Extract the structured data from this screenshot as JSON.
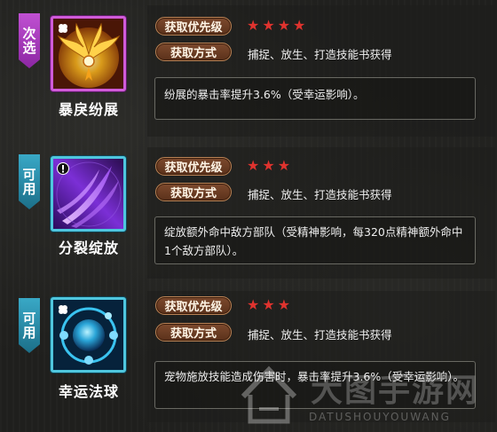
{
  "skills": [
    {
      "tag": "次选",
      "name": "暴戾纷展",
      "priority_label": "获取优先级",
      "stars": 4,
      "method_label": "获取方式",
      "method_text": "捕捉、放生、打造技能书获得",
      "description": "纷展的暴击率提升3.6%（受幸运影响）。",
      "tag_color": "#b33fc8",
      "icon": "golden-wings-icon"
    },
    {
      "tag": "可用",
      "name": "分裂绽放",
      "priority_label": "获取优先级",
      "stars": 3,
      "method_label": "获取方式",
      "method_text": "捕捉、放生、打造技能书获得",
      "description": "绽放额外命中敌方部队（受精神影响，每320点精神额外命中1个敌方部队）。",
      "tag_color": "#2b93b3",
      "icon": "purple-slash-icon"
    },
    {
      "tag": "可用",
      "name": "幸运法球",
      "priority_label": "获取优先级",
      "stars": 3,
      "method_label": "获取方式",
      "method_text": "捕捉、放生、打造技能书获得",
      "description": "宠物施放技能造成伤害时，暴击率提升3.6%（受幸运影响）。",
      "tag_color": "#2b93b3",
      "icon": "blue-orb-icon"
    }
  ],
  "watermark": {
    "brand": "大图手游网",
    "url": "DATUSHOUYOUWANG"
  }
}
